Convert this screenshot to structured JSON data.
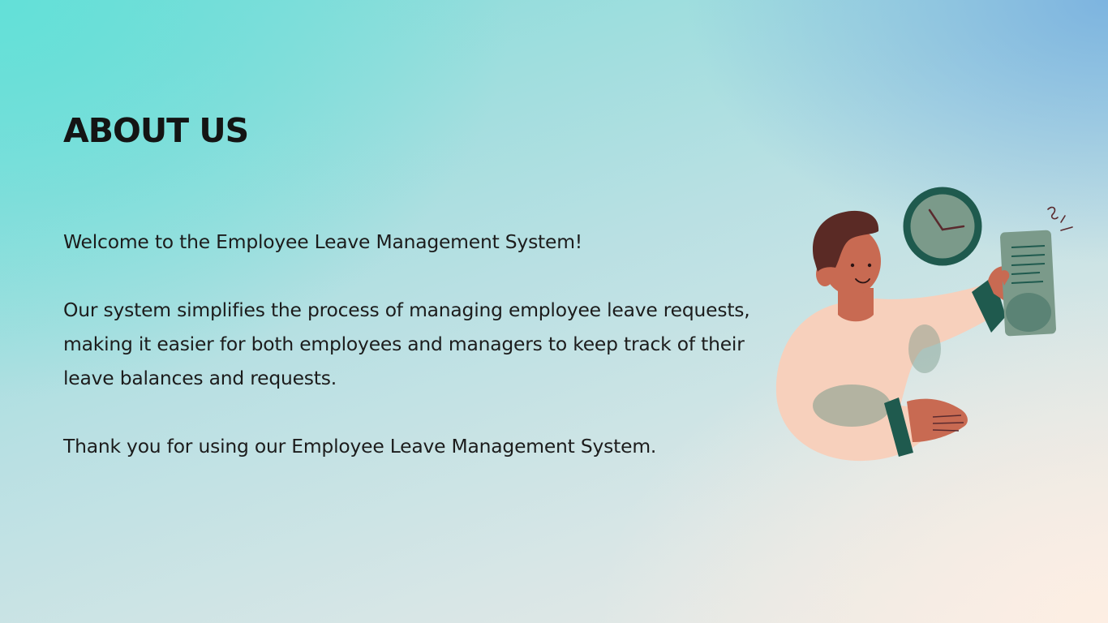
{
  "page": {
    "title": "ABOUT US",
    "paragraphs": {
      "welcome": "Welcome to the Employee Leave Management System!",
      "description": "Our system simplifies the process of managing employee leave requests, making it easier for both employees and managers to keep track of their leave balances and requests.",
      "thanks": "Thank you for using our Employee Leave Management System."
    }
  },
  "illustration": {
    "icon": "person-holding-document-with-clock-illustration"
  },
  "colors": {
    "title_text": "#141414",
    "body_text": "#1c1c1c",
    "gradient_top_left": "#63e0d8",
    "gradient_top_right": "#7db4e0",
    "gradient_bottom_right": "#fdeee3",
    "accent_dark_green": "#1f5a4e",
    "accent_sage": "#7b9a8a",
    "skin": "#c86a52",
    "shirt": "#f7d0bc",
    "hair": "#5a2a25"
  }
}
